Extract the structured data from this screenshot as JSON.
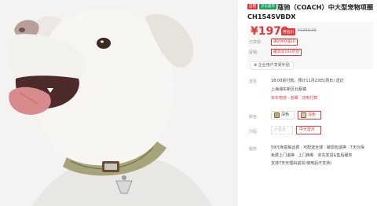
{
  "product": {
    "badges": [
      "自营",
      "京东超市"
    ],
    "title": "蔻驰（COACH）中大型宠物项圈 CH154SVBDX"
  },
  "price": {
    "current": "¥1979",
    "coupon_label": "券后价",
    "original": "¥1999.00",
    "rows": [
      {
        "label": "已享受:",
        "value": "满2000减20"
      },
      {
        "label": "促销:",
        "value": "最高返192京豆"
      }
    ],
    "benefit": "企业用户享受补贴"
  },
  "delivery": {
    "label": "送至",
    "line1": "18:00前付款，预计11月23日(周日) 送达",
    "line2": "上海浦东新区北蔡镇",
    "services": "京东物流 · 包邮 · 货到付款"
  },
  "color": {
    "label": "颜色",
    "options": [
      {
        "name": "深色",
        "selected": false
      },
      {
        "name": "浅色",
        "selected": true
      }
    ]
  },
  "size": {
    "label": "尺码",
    "options": [
      {
        "name": "小型犬",
        "selected": false,
        "disabled": true
      },
      {
        "name": "中大型犬",
        "selected": true,
        "disabled": false
      }
    ]
  },
  "service": {
    "label": "服务",
    "lines": [
      "59元免基础运费 · 可配送全球 · 破损包退换 · 7天价保",
      "免费上门退换 · 上门换新 · 京东发货&售后服务",
      "支持7天无理由退货(使用后不支持)"
    ]
  },
  "icons": {
    "favorite": "heart-outline-icon",
    "plus": "plus-circle-icon"
  }
}
